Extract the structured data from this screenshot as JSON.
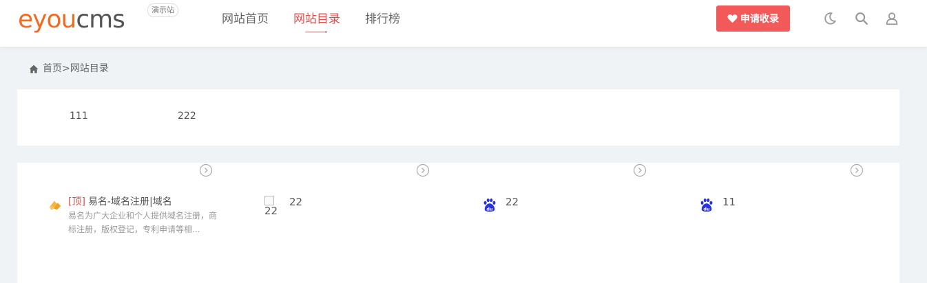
{
  "header": {
    "logo": {
      "e": "e",
      "you": "you",
      "cms": "cms"
    },
    "demo_badge": "演示站",
    "nav": [
      {
        "label": "网站首页",
        "active": false
      },
      {
        "label": "网站目录",
        "active": true
      },
      {
        "label": "排行榜",
        "active": false
      }
    ],
    "apply_button": "申请收录",
    "icons": [
      "moon-icon",
      "search-icon",
      "user-icon"
    ],
    "colors": {
      "brand_orange": "#f26b21",
      "accent_red": "#ed4a4a",
      "button_red": "#f25a5a"
    }
  },
  "breadcrumb": {
    "home": "首页",
    "separator": ">",
    "current": "网站目录"
  },
  "categories": [
    "111",
    "222"
  ],
  "sites": [
    {
      "top_tag": "[顶]",
      "name": "易名-域名注册|域名",
      "desc": "易名为广大企业和个人提供域名注册，商标注册，版权登记，专利申请等相...",
      "icon": "yiming-logo-icon"
    },
    {
      "name": "22",
      "broken_image_alt": "22",
      "icon": "broken-image-icon"
    },
    {
      "name": "22",
      "icon": "baidu-icon"
    },
    {
      "name": "11",
      "icon": "baidu-icon"
    }
  ]
}
